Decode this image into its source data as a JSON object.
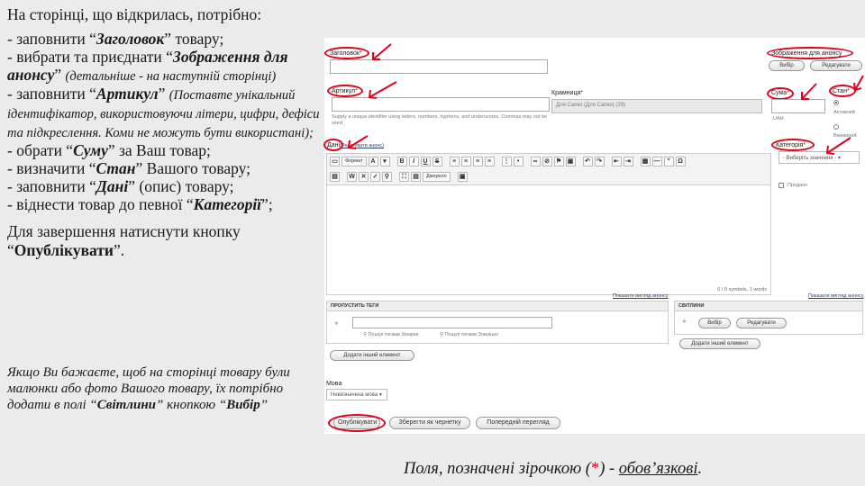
{
  "instructions": {
    "intro": "На сторінці, що відкрилась, потрібно:",
    "items": [
      {
        "pre": "- заповнити “",
        "bold": "Заголовок",
        "post": "” товару;",
        "note": ""
      },
      {
        "pre": "- вибрати та приєднати “",
        "bold": "Зображення для анонсу",
        "post": "” ",
        "note": "(детальніше - на наступній сторінці)"
      },
      {
        "pre": "- заповнити “",
        "bold": "Артикул",
        "post": "” ",
        "note": "(Поставте унікальний ідентифікатор, використовуючи літери, цифри, дефіси та підкреслення. Коми не можуть бути використані);"
      },
      {
        "pre": "- обрати “",
        "bold": "Суму",
        "post": "” за Ваш товар;",
        "note": ""
      },
      {
        "pre": "- визначити “",
        "bold": "Стан",
        "post": "” Вашого товару;",
        "note": ""
      },
      {
        "pre": "- заповнити “",
        "bold": "Дані",
        "post": "” (опис) товару;",
        "note": ""
      },
      {
        "pre": "- віднести товар до певної “",
        "bold": "Категорії",
        "post": "”;",
        "note": ""
      }
    ],
    "finish_pre": "Для завершення натиснути кнопку “",
    "finish_bold": "Опублікувати",
    "finish_post": "”.",
    "tip_pre": "Якщо Ви бажаєте, щоб на сторінці товару були малюнки або фото Вашого товару, їх потрібно додати в полі “",
    "tip_bold1": "Світлини",
    "tip_mid": "” кнопкою “",
    "tip_bold2": "Вибір",
    "tip_post": "”"
  },
  "footnote": {
    "pre": "Поля, позначені зірочкою (",
    "star": "*",
    "mid": ") - ",
    "underlined": "обов’язкові",
    "post": "."
  },
  "form": {
    "title_label": "Заголовок",
    "image_label": "Зображення для анонсу",
    "image_choose_btn": "Вибір",
    "image_edit_btn": "Редагувати",
    "sku_label": "Артикул",
    "sku_hint": "Supply a unique identifier using letters, numbers, hyphens, and underscores. Commas may not be used.",
    "store_label": "Крамниця",
    "store_value": "Для Сапко (Для Сапко) (29)",
    "price_label": "Сума",
    "price_currency": "UAH",
    "state_label": "Стан",
    "state_options": [
      "Активний",
      "Вживаний"
    ],
    "body_label": "Дані",
    "body_edit_summary": "(Редагувати анонс)",
    "format_select": "Формат",
    "source_btn": "Джерело",
    "counter": "0 / 0 symbols, 1 words",
    "category_label": "Категорія",
    "category_select": "- Виберіть значення -",
    "sold_checkbox": "Продано",
    "add_summary_link": "Показати вигляд анонсу",
    "add_summary_link2": "Показати вигляд анонсу",
    "tags_header": "ПРОПУСТИТЬ ТЕГИ",
    "tags_search1": "Пошук тегами Хмарки",
    "tags_search2": "Пошук тегами Зовнішні",
    "tags_add_btn": "Додати інший елемент",
    "photos_header": "СВІТЛИНИ",
    "photos_choose_btn": "Вибір",
    "photos_edit_btn": "Редагувати",
    "photos_add_btn": "Додати інший елемент",
    "menu_label": "Мова",
    "menu_select": "Невизначена мова",
    "publish_btn": "Опублікувати",
    "save_draft_btn": "Зберегти як чернетку",
    "preview_btn": "Попередній перегляд"
  },
  "accent_color": "#e3001b"
}
